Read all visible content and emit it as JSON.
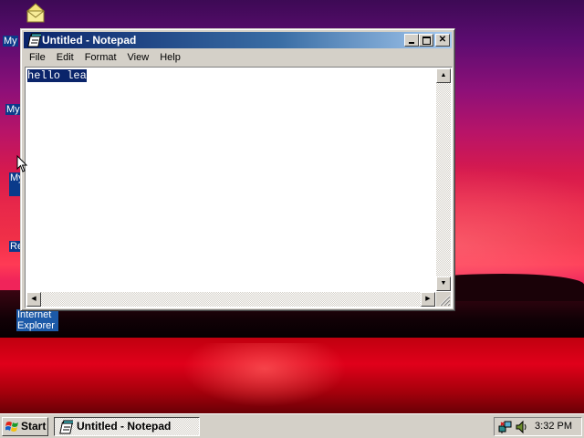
{
  "desktop": {
    "icons": [
      {
        "label": "My",
        "kind": "my-documents"
      },
      {
        "label": "My",
        "kind": "my-computer"
      },
      {
        "label": "My",
        "kind": "my-network-places"
      },
      {
        "label": "Re",
        "kind": "recycle-bin"
      },
      {
        "label": "Internet Explorer",
        "kind": "internet-explorer"
      }
    ]
  },
  "window": {
    "title": "Untitled - Notepad",
    "icon": "notepad-icon",
    "controls": [
      "minimize",
      "maximize",
      "close"
    ],
    "menu": [
      "File",
      "Edit",
      "Format",
      "View",
      "Help"
    ],
    "content": "hello lea",
    "selected_text": "hello lea"
  },
  "taskbar": {
    "start_label": "Start",
    "tasks": [
      {
        "label": "Untitled - Notepad",
        "active": true
      }
    ],
    "tray_icons": [
      "network-icon",
      "volume-icon"
    ],
    "clock": "3:32 PM"
  },
  "colors": {
    "title_active": "#0a246a",
    "selection": "#0a246a",
    "face": "#d4d0c8"
  }
}
